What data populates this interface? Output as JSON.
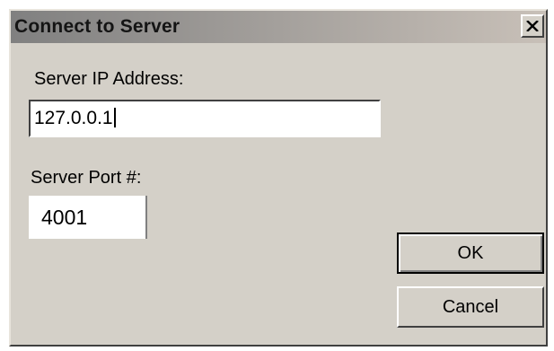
{
  "dialog": {
    "title": "Connect to Server",
    "close_icon": "close-icon",
    "server_ip": {
      "label": "Server IP Address:",
      "value": "127.0.0.1"
    },
    "server_port": {
      "label": "Server Port #:",
      "value": "4001"
    },
    "buttons": {
      "ok_label": "OK",
      "cancel_label": "Cancel"
    }
  }
}
